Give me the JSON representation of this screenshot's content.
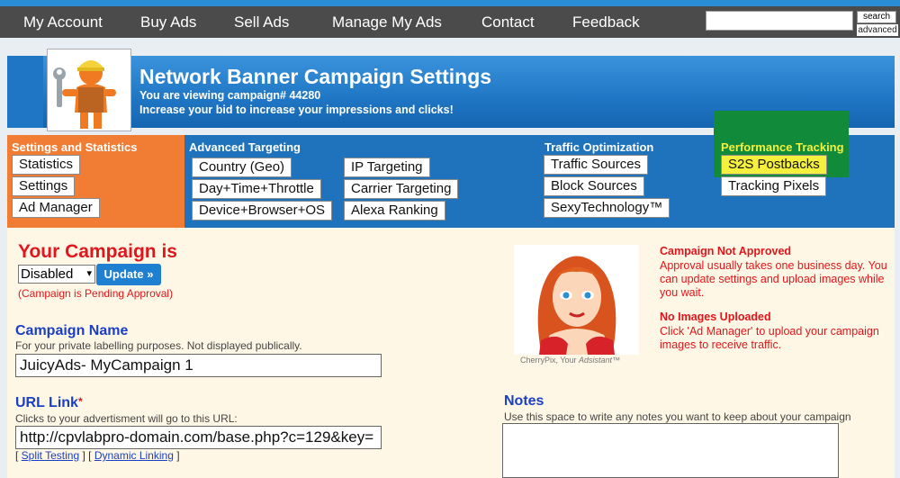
{
  "nav": {
    "items": [
      "My Account",
      "Buy Ads",
      "Sell Ads",
      "Manage My Ads",
      "Contact",
      "Feedback"
    ],
    "search_button": "search",
    "advanced": "advanced"
  },
  "header": {
    "title": "Network Banner Campaign Settings",
    "viewing": "You are viewing campaign# 44280",
    "tagline": "Increase your bid to increase your impressions and clicks!"
  },
  "sections": {
    "settings_stats": {
      "title": "Settings and Statistics",
      "buttons": [
        "Statistics",
        "Settings",
        "Ad Manager"
      ]
    },
    "advanced_targeting": {
      "title": "Advanced Targeting",
      "buttons": [
        "Country (Geo)",
        "Day+Time+Throttle",
        "Device+Browser+OS",
        "IP Targeting",
        "Carrier Targeting",
        "Alexa Ranking"
      ]
    },
    "traffic_optimization": {
      "title": "Traffic Optimization",
      "buttons": [
        "Traffic Sources",
        "Block Sources",
        "SexyTechnology™"
      ]
    },
    "performance_tracking": {
      "title": "Performance Tracking",
      "buttons": [
        "S2S Postbacks",
        "Tracking Pixels"
      ]
    }
  },
  "campaign": {
    "status_title": "Your Campaign is",
    "status_value": "Disabled",
    "update_label": "Update »",
    "pending": "(Campaign is Pending Approval)",
    "name_label": "Campaign Name",
    "name_help": "For your private labelling purposes. Not displayed publically.",
    "name_value": "JuicyAds- MyCampaign 1",
    "url_label": "URL Link",
    "required_mark": "*",
    "url_help": "Clicks to your advertisment will go to this URL:",
    "url_value": "http://cpvlabpro-domain.com/base.php?c=129&key=",
    "split_testing": "Split Testing",
    "dynamic_linking": "Dynamic Linking"
  },
  "assistant": {
    "caption_prefix": "CherryPix, Your ",
    "caption_em": "Adsistant",
    "caption_tm": "™"
  },
  "notices": {
    "not_approved_title": "Campaign Not Approved",
    "not_approved_text": "Approval usually takes one business day. You can update settings and upload images while you wait.",
    "no_images_title": "No Images Uploaded",
    "no_images_text": "Click 'Ad Manager' to upload your campaign images to receive traffic."
  },
  "notes": {
    "label": "Notes",
    "help": "Use this space to write any notes you want to keep about your campaign"
  },
  "colors": {
    "nav_bg": "#4b4b4b",
    "accent_blue": "#1f73bd",
    "orange": "#f17d34",
    "highlight_green": "#118a3a",
    "highlight_yellow": "#f5f03d",
    "alert_red": "#e0161c",
    "content_bg": "#fff7e5"
  }
}
